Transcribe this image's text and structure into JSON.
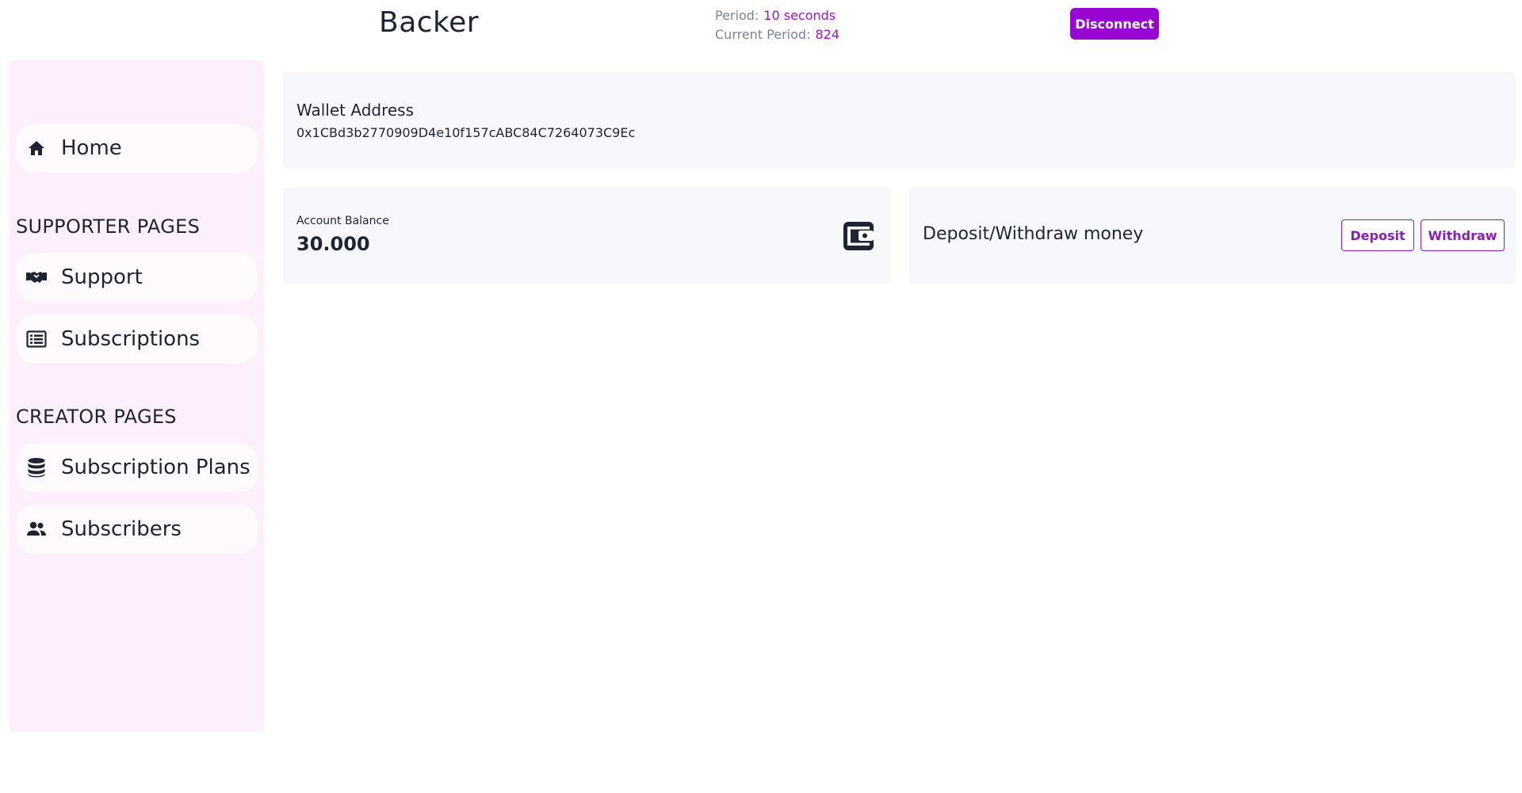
{
  "header": {
    "title": "Backer",
    "period_label": "Period:",
    "period_value": "10 seconds",
    "current_period_label": "Current Period:",
    "current_period_value": "824",
    "disconnect_label": "Disconnect"
  },
  "sidebar": {
    "home": {
      "label": "Home",
      "icon": "home-icon"
    },
    "supporter_heading": "SUPPORTER PAGES",
    "supporter_items": [
      {
        "label": "Support",
        "icon": "handshake-icon"
      },
      {
        "label": "Subscriptions",
        "icon": "list-icon"
      }
    ],
    "creator_heading": "CREATOR PAGES",
    "creator_items": [
      {
        "label": "Subscription Plans",
        "icon": "database-icon"
      },
      {
        "label": "Subscribers",
        "icon": "people-icon"
      }
    ]
  },
  "main": {
    "wallet": {
      "title": "Wallet Address",
      "address": "0x1CBd3b2770909D4e10f157cABC84C7264073C9Ec"
    },
    "balance": {
      "label": "Account Balance",
      "value": "30.000",
      "icon": "wallet-icon"
    },
    "deposit_withdraw": {
      "title": "Deposit/Withdraw money",
      "deposit_label": "Deposit",
      "withdraw_label": "Withdraw"
    }
  },
  "colors": {
    "accent": "#9906d4",
    "sidebar_bg": "#fdf0fc",
    "card_bg": "#f6f8fb"
  }
}
